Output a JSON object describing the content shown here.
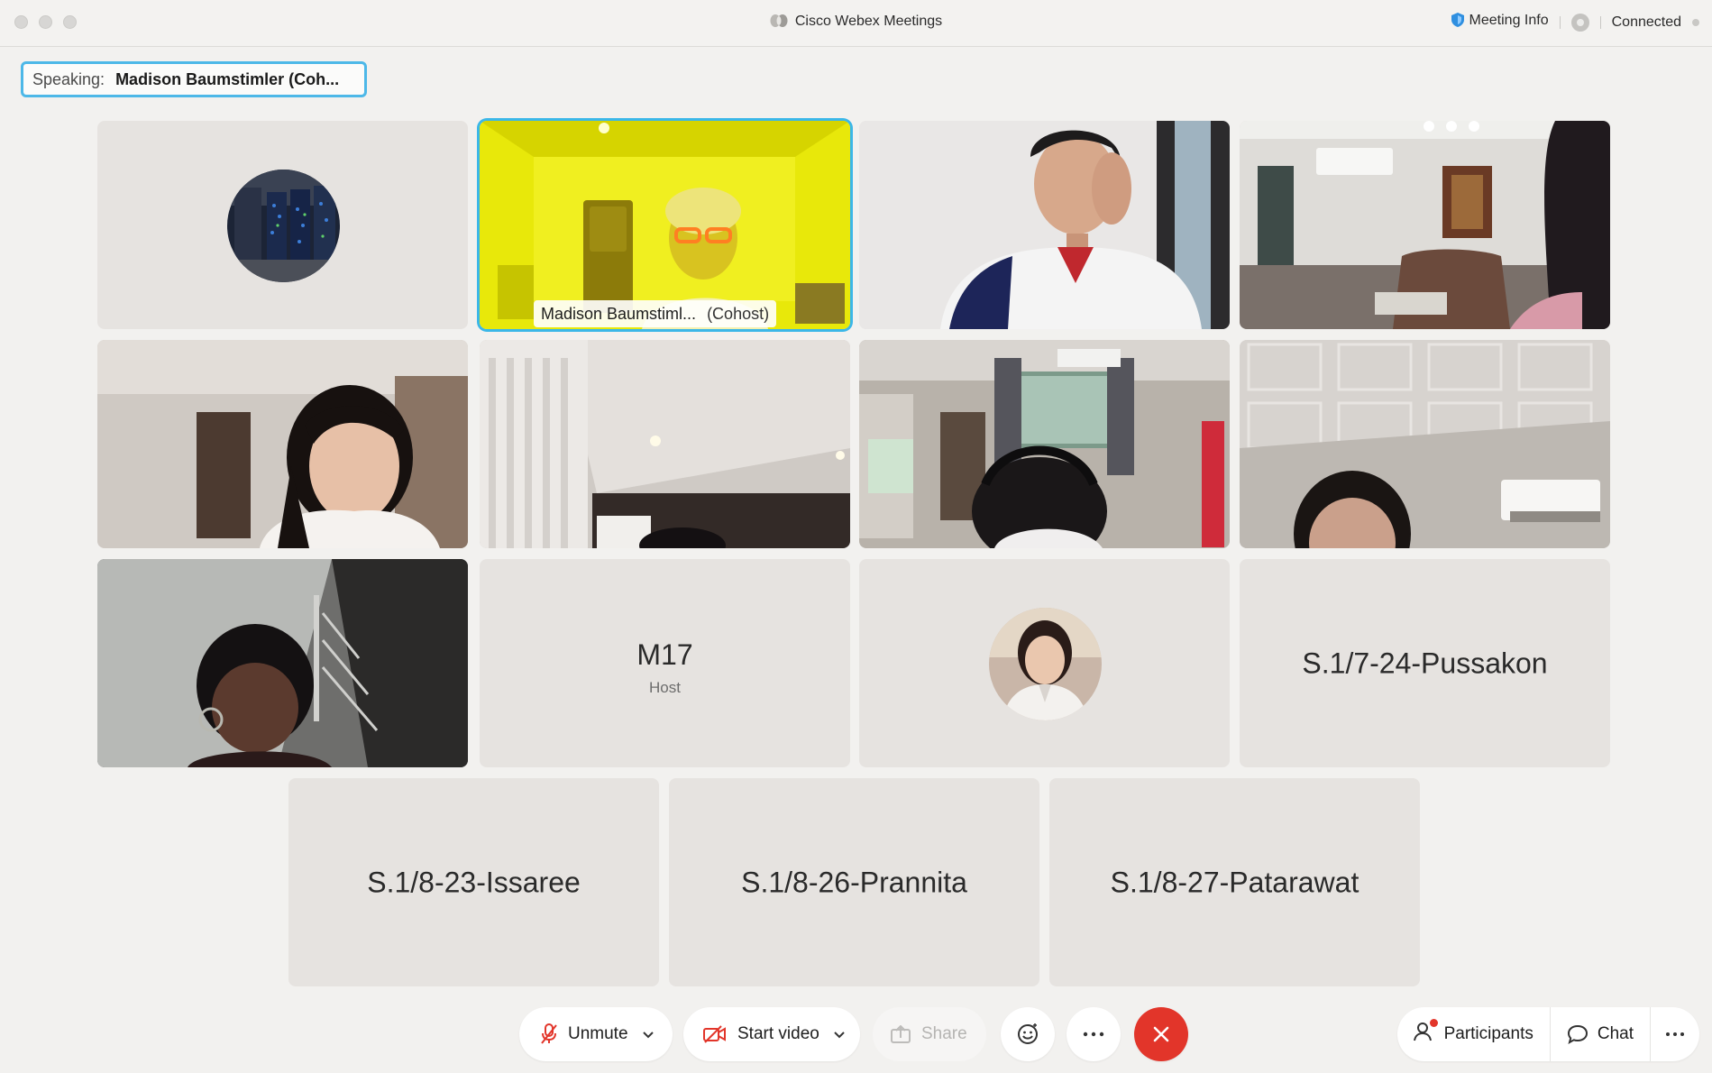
{
  "window": {
    "title": "Cisco Webex Meetings",
    "meeting_info": "Meeting Info",
    "connection_status": "Connected"
  },
  "speaking": {
    "label": "Speaking:",
    "name": "Madison Baumstimler (Coh..."
  },
  "participants": [
    {
      "id": "p1",
      "type": "avatar",
      "avatar_icon": "server-room-avatar"
    },
    {
      "id": "p2",
      "type": "video",
      "name": "Madison Baumstiml...",
      "role": "(Cohost)",
      "active_speaker": true
    },
    {
      "id": "p3",
      "type": "video"
    },
    {
      "id": "p4",
      "type": "video"
    },
    {
      "id": "p5",
      "type": "video"
    },
    {
      "id": "p6",
      "type": "video"
    },
    {
      "id": "p7",
      "type": "video"
    },
    {
      "id": "p8",
      "type": "video"
    },
    {
      "id": "p9",
      "type": "video"
    },
    {
      "id": "p10",
      "type": "name",
      "name": "M17",
      "role": "Host"
    },
    {
      "id": "p11",
      "type": "avatar",
      "avatar_icon": "person-photo-avatar"
    },
    {
      "id": "p12",
      "type": "name",
      "name": "S.1/7-24-Pussakon"
    },
    {
      "id": "p13",
      "type": "name",
      "name": "S.1/8-23-Issaree"
    },
    {
      "id": "p14",
      "type": "name",
      "name": "S.1/8-26-Prannita"
    },
    {
      "id": "p15",
      "type": "name",
      "name": "S.1/8-27-Patarawat"
    }
  ],
  "toolbar": {
    "unmute": "Unmute",
    "start_video": "Start video",
    "share": "Share",
    "participants": "Participants",
    "chat": "Chat"
  },
  "colors": {
    "accent": "#3bb7e8",
    "end_call": "#e2352a",
    "muted_icon": "#e2352a"
  }
}
